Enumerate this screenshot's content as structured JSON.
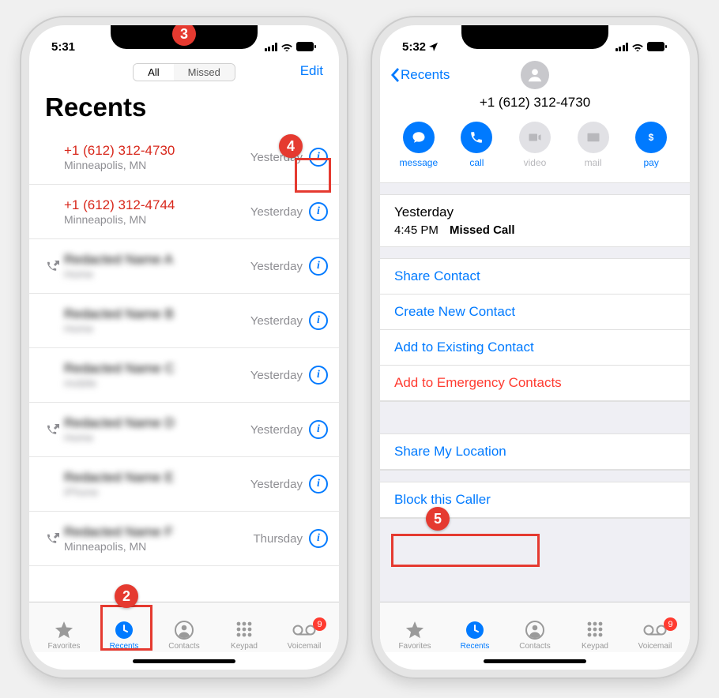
{
  "left": {
    "status_time": "5:31",
    "segmented": {
      "all": "All",
      "missed": "Missed"
    },
    "edit": "Edit",
    "title": "Recents",
    "calls": [
      {
        "number": "+1 (612) 312-4730",
        "sub": "Minneapolis, MN",
        "time": "Yesterday",
        "missed": true,
        "outgoing": false,
        "blur": false
      },
      {
        "number": "+1 (612) 312-4744",
        "sub": "Minneapolis, MN",
        "time": "Yesterday",
        "missed": true,
        "outgoing": false,
        "blur": false
      },
      {
        "number": "Redacted Name A",
        "sub": "Home",
        "time": "Yesterday",
        "missed": false,
        "outgoing": true,
        "blur": true
      },
      {
        "number": "Redacted Name B",
        "sub": "Home",
        "time": "Yesterday",
        "missed": false,
        "outgoing": false,
        "blur": true
      },
      {
        "number": "Redacted Name C",
        "sub": "mobile",
        "time": "Yesterday",
        "missed": false,
        "outgoing": false,
        "blur": true
      },
      {
        "number": "Redacted Name D",
        "sub": "Home",
        "time": "Yesterday",
        "missed": false,
        "outgoing": true,
        "blur": true
      },
      {
        "number": "Redacted Name E",
        "sub": "iPhone",
        "time": "Yesterday",
        "missed": false,
        "outgoing": false,
        "blur": true
      },
      {
        "number": "Redacted Name F",
        "sub": "Minneapolis, MN",
        "time": "Thursday",
        "missed": false,
        "outgoing": true,
        "blur": true,
        "subBlur": false
      }
    ],
    "annotations": {
      "a2": "2",
      "a3": "3",
      "a4": "4"
    }
  },
  "right": {
    "status_time": "5:32",
    "back": "Recents",
    "number": "+1 (612) 312-4730",
    "actions": {
      "message": "message",
      "call": "call",
      "video": "video",
      "mail": "mail",
      "pay": "pay"
    },
    "log_day": "Yesterday",
    "log_time": "4:45 PM",
    "log_kind": "Missed Call",
    "links": {
      "share_contact": "Share Contact",
      "create_new": "Create New Contact",
      "add_existing": "Add to Existing Contact",
      "add_emergency": "Add to Emergency Contacts",
      "share_location": "Share My Location",
      "block": "Block this Caller"
    },
    "annotations": {
      "a5": "5"
    }
  },
  "tabs": {
    "favorites": "Favorites",
    "recents": "Recents",
    "contacts": "Contacts",
    "keypad": "Keypad",
    "voicemail": "Voicemail",
    "voicemail_badge": "9"
  }
}
